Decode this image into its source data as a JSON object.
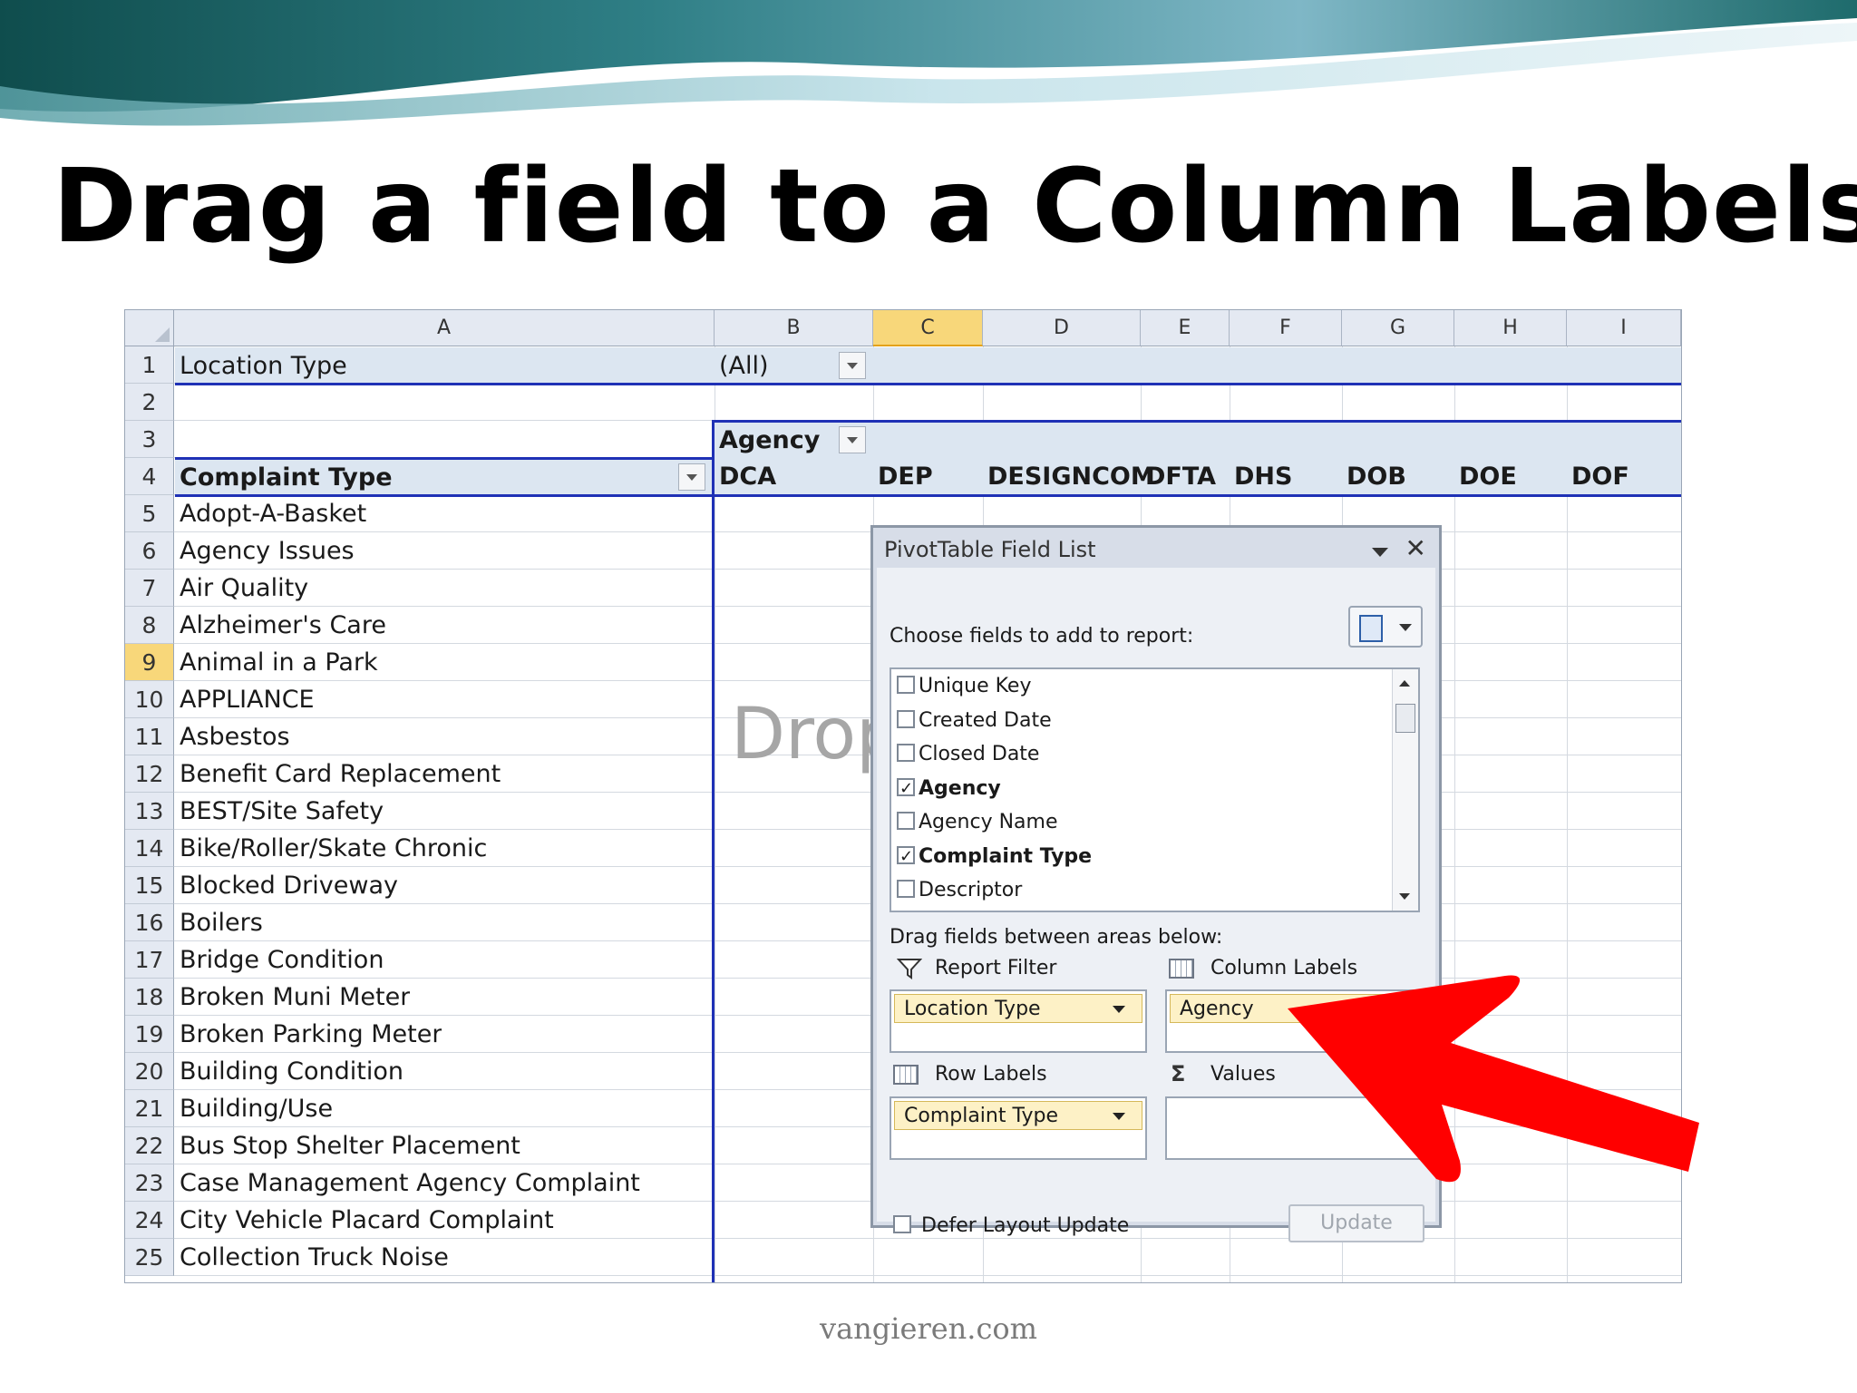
{
  "slide": {
    "title": "Drag a field to a Column Labels",
    "footer": "vangieren.com"
  },
  "sheet": {
    "columns": [
      "A",
      "B",
      "C",
      "D",
      "E",
      "F",
      "G",
      "H",
      "I"
    ],
    "selected_column": "C",
    "selected_row": 9,
    "rows": [
      "1",
      "2",
      "3",
      "4",
      "5",
      "6",
      "7",
      "8",
      "9",
      "10",
      "11",
      "12",
      "13",
      "14",
      "15",
      "16",
      "17",
      "18",
      "19",
      "20",
      "21",
      "22",
      "23",
      "24",
      "25"
    ],
    "filter": {
      "label": "Location Type",
      "value": "(All)"
    },
    "column_field": "Agency",
    "row_field": "Complaint Type",
    "column_items": [
      "DCA",
      "DEP",
      "DESIGNCOM",
      "DFTA",
      "DHS",
      "DOB",
      "DOE",
      "DOF"
    ],
    "row_items": [
      "Adopt-A-Basket",
      "Agency Issues",
      "Air Quality",
      "Alzheimer's Care",
      "Animal in a Park",
      "APPLIANCE",
      "Asbestos",
      "Benefit Card Replacement",
      "BEST/Site Safety",
      "Bike/Roller/Skate Chronic",
      "Blocked Driveway",
      "Boilers",
      "Bridge Condition",
      "Broken Muni Meter",
      "Broken Parking Meter",
      "Building Condition",
      "Building/Use",
      "Bus Stop Shelter Placement",
      "Case Management Agency Complaint",
      "City Vehicle Placard Complaint",
      "Collection Truck Noise"
    ],
    "drop_hint": "Drop"
  },
  "field_list": {
    "title": "PivotTable Field List",
    "choose_label": "Choose fields to add to report:",
    "fields": [
      {
        "name": "Unique Key",
        "checked": false
      },
      {
        "name": "Created Date",
        "checked": false
      },
      {
        "name": "Closed Date",
        "checked": false
      },
      {
        "name": "Agency",
        "checked": true
      },
      {
        "name": "Agency Name",
        "checked": false
      },
      {
        "name": "Complaint Type",
        "checked": true
      },
      {
        "name": "Descriptor",
        "checked": false
      }
    ],
    "drag_label": "Drag fields between areas below:",
    "areas": {
      "report_filter": {
        "label": "Report Filter",
        "item": "Location Type"
      },
      "column_labels": {
        "label": "Column Labels",
        "item": "Agency"
      },
      "row_labels": {
        "label": "Row Labels",
        "item": "Complaint Type"
      },
      "values": {
        "label": "Values",
        "item": ""
      }
    },
    "defer_label": "Defer Layout Update",
    "update_label": "Update"
  },
  "colors": {
    "pivot_border": "#1f31b6",
    "selection": "#f8d77a",
    "arrow": "#ff0000"
  }
}
